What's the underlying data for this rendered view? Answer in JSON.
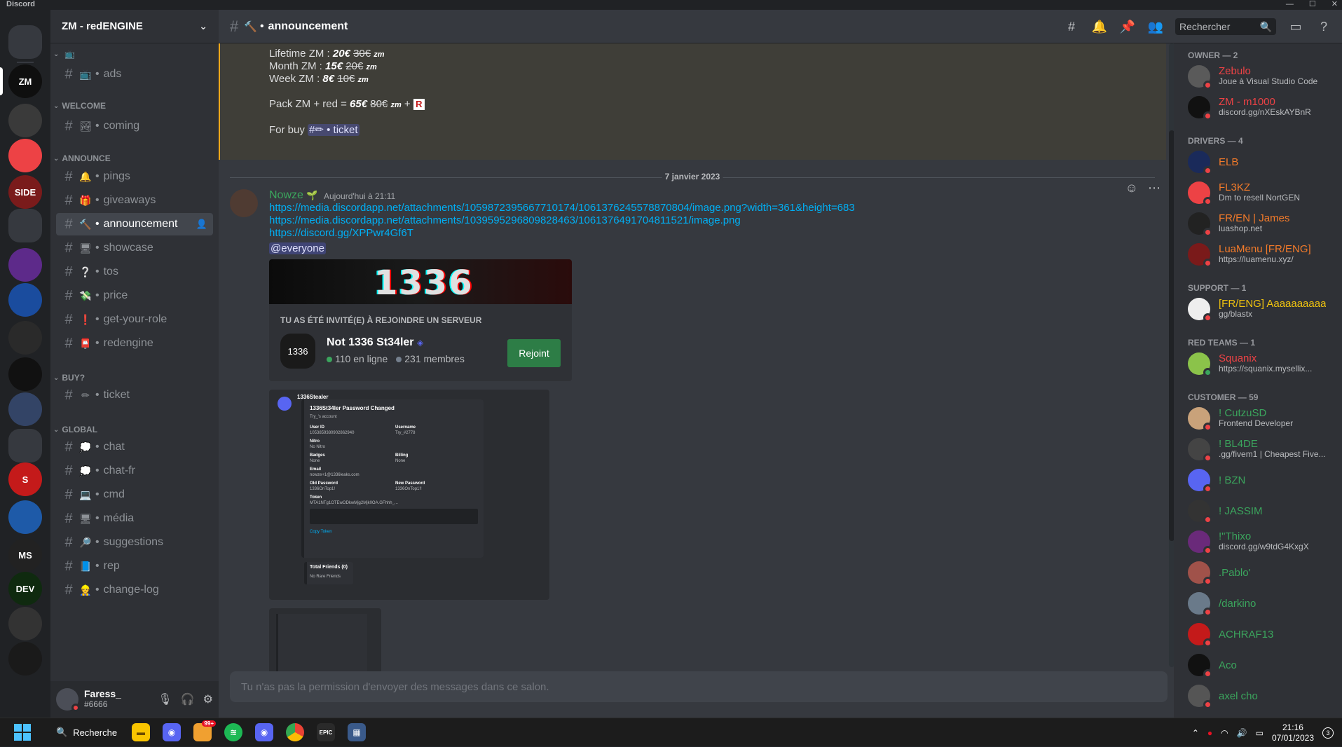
{
  "window": {
    "title": "Discord",
    "controls": [
      "—",
      "☐",
      "✕"
    ]
  },
  "guild": {
    "name": "ZM - redENGINE"
  },
  "server_rail": [
    {
      "name": "dm-home",
      "label": "",
      "color": "#36393f"
    },
    {
      "name": "zm",
      "label": "ZM",
      "color": "#0f0f0f"
    },
    {
      "name": "server-2",
      "label": "",
      "color": "#3a3a3a"
    },
    {
      "name": "server-3",
      "label": "",
      "color": "#ed4245"
    },
    {
      "name": "side",
      "label": "SIDE",
      "color": "#7a1b1b"
    },
    {
      "name": "folder-1",
      "label": "",
      "color": "#36393f"
    },
    {
      "name": "server-5",
      "label": "",
      "color": "#5d2a8a"
    },
    {
      "name": "server-6",
      "label": "",
      "color": "#1a4c9e"
    },
    {
      "name": "server-7",
      "label": "",
      "color": "#2a2a2a"
    },
    {
      "name": "server-8",
      "label": "",
      "color": "#111111"
    },
    {
      "name": "server-9",
      "label": "",
      "color": "#334466"
    },
    {
      "name": "folder-2",
      "label": "",
      "color": "#36393f"
    },
    {
      "name": "server-10",
      "label": "S",
      "color": "#c41a1a"
    },
    {
      "name": "server-11",
      "label": "",
      "color": "#1e5aa8"
    },
    {
      "name": "server-12",
      "label": "MS",
      "color": "#222222"
    },
    {
      "name": "dev",
      "label": "DEV",
      "color": "#0f2a0f"
    },
    {
      "name": "server-14",
      "label": "",
      "color": "#333333"
    },
    {
      "name": "server-15",
      "label": "",
      "color": "#1a1a1a"
    }
  ],
  "channels": {
    "categories": [
      {
        "label": "",
        "icon": "📺"
      },
      {
        "label": "WELCOME"
      },
      {
        "label": "ANNOUNCE"
      },
      {
        "label": "BUY?"
      },
      {
        "label": "GLOBAL"
      }
    ],
    "items": [
      {
        "label": "ads",
        "emoji": "📺"
      },
      {
        "label": "coming",
        "emoji": "🏞"
      },
      {
        "label": "pings",
        "emoji": "🔔"
      },
      {
        "label": "giveaways",
        "emoji": "🎁"
      },
      {
        "label": "announcement",
        "emoji": "🔨"
      },
      {
        "label": "showcase",
        "emoji": "🖥"
      },
      {
        "label": "tos",
        "emoji": "❔"
      },
      {
        "label": "price",
        "emoji": "💸"
      },
      {
        "label": "get-your-role",
        "emoji": "❗"
      },
      {
        "label": "redengine",
        "emoji": "📮"
      },
      {
        "label": "ticket",
        "emoji": "✏"
      },
      {
        "label": "chat",
        "emoji": "💭"
      },
      {
        "label": "chat-fr",
        "emoji": "💭"
      },
      {
        "label": "cmd",
        "emoji": "💻"
      },
      {
        "label": "média",
        "emoji": "🖥"
      },
      {
        "label": "suggestions",
        "emoji": "🔎"
      },
      {
        "label": "rep",
        "emoji": "📘"
      },
      {
        "label": "change-log",
        "emoji": "👷"
      }
    ]
  },
  "user": {
    "name": "Faress_",
    "tag": "#6666"
  },
  "header": {
    "channel": "announcement",
    "search_placeholder": "Rechercher"
  },
  "pinned_message": {
    "lifetime": {
      "label": "Lifetime ZM : ",
      "price": "20€",
      "old": "30€",
      "tag": "zm"
    },
    "month": {
      "label": "Month ZM : ",
      "price": "15€",
      "old": "20€",
      "tag": "zm"
    },
    "week": {
      "label": "Week ZM : ",
      "price": "8€",
      "old": "10€",
      "tag": "zm"
    },
    "pack": {
      "label": "Pack ZM + red = ",
      "price": "65€",
      "old": "80€",
      "tag": "zm",
      "plus": " + "
    },
    "for_buy": "For buy",
    "ticket_mention": "#✏ • ticket"
  },
  "date_divider": "7 janvier 2023",
  "message": {
    "author": "Nowze",
    "timestamp": "Aujourd'hui à 21:11",
    "links": [
      "https://media.discordapp.net/attachments/1059872395667710174/1061376245578870804/image.png?width=361&height=683",
      "https://media.discordapp.net/attachments/1039595296809828463/1061376491704811521/image.png",
      "https://discord.gg/XPPwr4Gf6T"
    ],
    "mention": "@everyone"
  },
  "invite": {
    "banner_text": "1336",
    "title": "TU AS ÉTÉ INVITÉ(E) À REJOINDRE UN SERVEUR",
    "server": "Not 1336 St34ler",
    "online": "110 en ligne",
    "members": "231 membres",
    "button": "Rejoint",
    "icon_text": "1336"
  },
  "embed_image": {
    "bot": "1336Stealer",
    "title": "1336St34ler Password Changed",
    "account": "Try_'s account",
    "fields": [
      {
        "k": "User ID",
        "v": "1053859380902862940"
      },
      {
        "k": "Username",
        "v": "Try_#2778"
      },
      {
        "k": "Nitro",
        "v": "No Nitro"
      },
      {
        "k": "Badges",
        "v": "None"
      },
      {
        "k": "Billing",
        "v": "None"
      },
      {
        "k": "Email",
        "v": "nowze+1@1336leaks.com"
      },
      {
        "k": "Old Password",
        "v": "1336OnTop1!"
      },
      {
        "k": "New Password",
        "v": "1336OnTop1!!"
      },
      {
        "k": "Token",
        "v": "MTA1NTg1OTEwODkwMjg2Mjk0OA.GFhhh_..."
      },
      {
        "k": "Total Friends (0)",
        "v": "No Rare Friends"
      }
    ],
    "copy": "Copy Token"
  },
  "input_placeholder": "Tu n'as pas la permission d'envoyer des messages dans ce salon.",
  "members": {
    "groups": [
      {
        "label": "OWNER — 2",
        "items": [
          {
            "name": "Zebulo",
            "status": "Joue à Visual Studio Code",
            "color": "#ed4245",
            "av": "#5a5a5a"
          },
          {
            "name": "ZM - m1000",
            "status": "discord.gg/nXEskAYBnR",
            "color": "#ed4245",
            "av": "#111"
          }
        ]
      },
      {
        "label": "DRIVERS — 4",
        "items": [
          {
            "name": "ELB",
            "status": "",
            "color": "#f47b2a",
            "av": "#1a2a5a"
          },
          {
            "name": "FL3KZ",
            "status": "Dm to resell NortGEN",
            "color": "#f47b2a",
            "av": "#ed4245"
          },
          {
            "name": "FR/EN | James",
            "status": "luashop.net",
            "color": "#f47b2a",
            "av": "#222"
          },
          {
            "name": "LuaMenu [FR/ENG]",
            "status": "https://luamenu.xyz/",
            "color": "#f47b2a",
            "av": "#7a1a1a"
          }
        ]
      },
      {
        "label": "SUPPORT — 1",
        "items": [
          {
            "name": "[FR/ENG] Aaaaaaaaaa",
            "status": "gg/blastx",
            "color": "#f1c40f",
            "av": "#eee"
          }
        ]
      },
      {
        "label": "RED TEAMS — 1",
        "items": [
          {
            "name": "Squanix",
            "status": "https://squanix.mysellix...",
            "color": "#ed4245",
            "av": "#8bc34a"
          }
        ]
      },
      {
        "label": "CUSTOMER — 59",
        "items": [
          {
            "name": "! CutzuSD",
            "status": "Frontend Developer",
            "color": "#3ba55d",
            "av": "#c9a27a"
          },
          {
            "name": "! BL4DE",
            "status": ".gg/fivem1 | Cheapest Five...",
            "color": "#3ba55d",
            "av": "#444"
          },
          {
            "name": "! BZN",
            "status": "",
            "color": "#3ba55d",
            "av": "#5865f2"
          },
          {
            "name": "! JASSIM",
            "status": "",
            "color": "#3ba55d",
            "av": "#333"
          },
          {
            "name": "!\"Thixo",
            "status": "discord.gg/w9tdG4KxgX",
            "color": "#3ba55d",
            "av": "#6a2a7a"
          },
          {
            "name": ".Pablo'",
            "status": "",
            "color": "#3ba55d",
            "av": "#a0524a"
          },
          {
            "name": "/darkino",
            "status": "",
            "color": "#3ba55d",
            "av": "#6a7a8a"
          },
          {
            "name": "ACHRAF13",
            "status": "",
            "color": "#3ba55d",
            "av": "#c41a1a"
          },
          {
            "name": "Aco",
            "status": "",
            "color": "#3ba55d",
            "av": "#111"
          },
          {
            "name": "axel cho",
            "status": "",
            "color": "#3ba55d",
            "av": "#555"
          }
        ]
      }
    ]
  },
  "taskbar": {
    "search": "Recherche",
    "apps": [
      "explorer",
      "discord",
      "badge-99",
      "spotify",
      "discord-2",
      "chrome",
      "epic",
      "calculator"
    ],
    "badge": "99+",
    "time": "21:16",
    "date": "07/01/2023",
    "notif": "3"
  }
}
